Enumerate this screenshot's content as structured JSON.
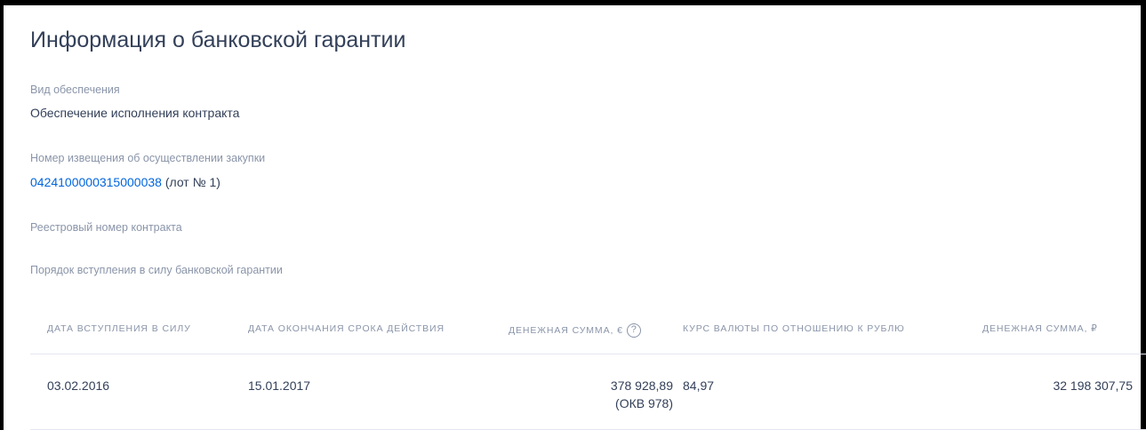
{
  "page": {
    "title": "Информация о банковской гарантии"
  },
  "fields": {
    "security_type": {
      "label": "Вид обеспечения",
      "value": "Обеспечение исполнения контракта"
    },
    "notice_number": {
      "label": "Номер извещения об осуществлении закупки",
      "link": "0424100000315000038",
      "suffix": "(лот № 1)"
    },
    "contract_registry_number": {
      "label": "Реестровый номер контракта"
    },
    "entry_procedure": {
      "label": "Порядок вступления в силу банковской гарантии"
    }
  },
  "table": {
    "columns": {
      "start_date": "Дата вступления в силу",
      "end_date": "Дата окончания срока действия",
      "amount_eur": "Денежная сумма, €",
      "rate": "Курс валюты по отношению к рублю",
      "amount_rub": "Денежная сумма, ₽"
    },
    "help_icon": "question-circle-icon",
    "rows": [
      {
        "start_date": "03.02.2016",
        "end_date": "15.01.2017",
        "amount_eur": "378 928,89",
        "amount_eur_code": "(ОКВ 978)",
        "rate": "84,97",
        "amount_rub": "32 198 307,75"
      }
    ]
  },
  "colors": {
    "text_primary": "#334059",
    "text_muted": "#8a95a9",
    "link": "#0065dd",
    "divider": "#e4e7f2"
  }
}
